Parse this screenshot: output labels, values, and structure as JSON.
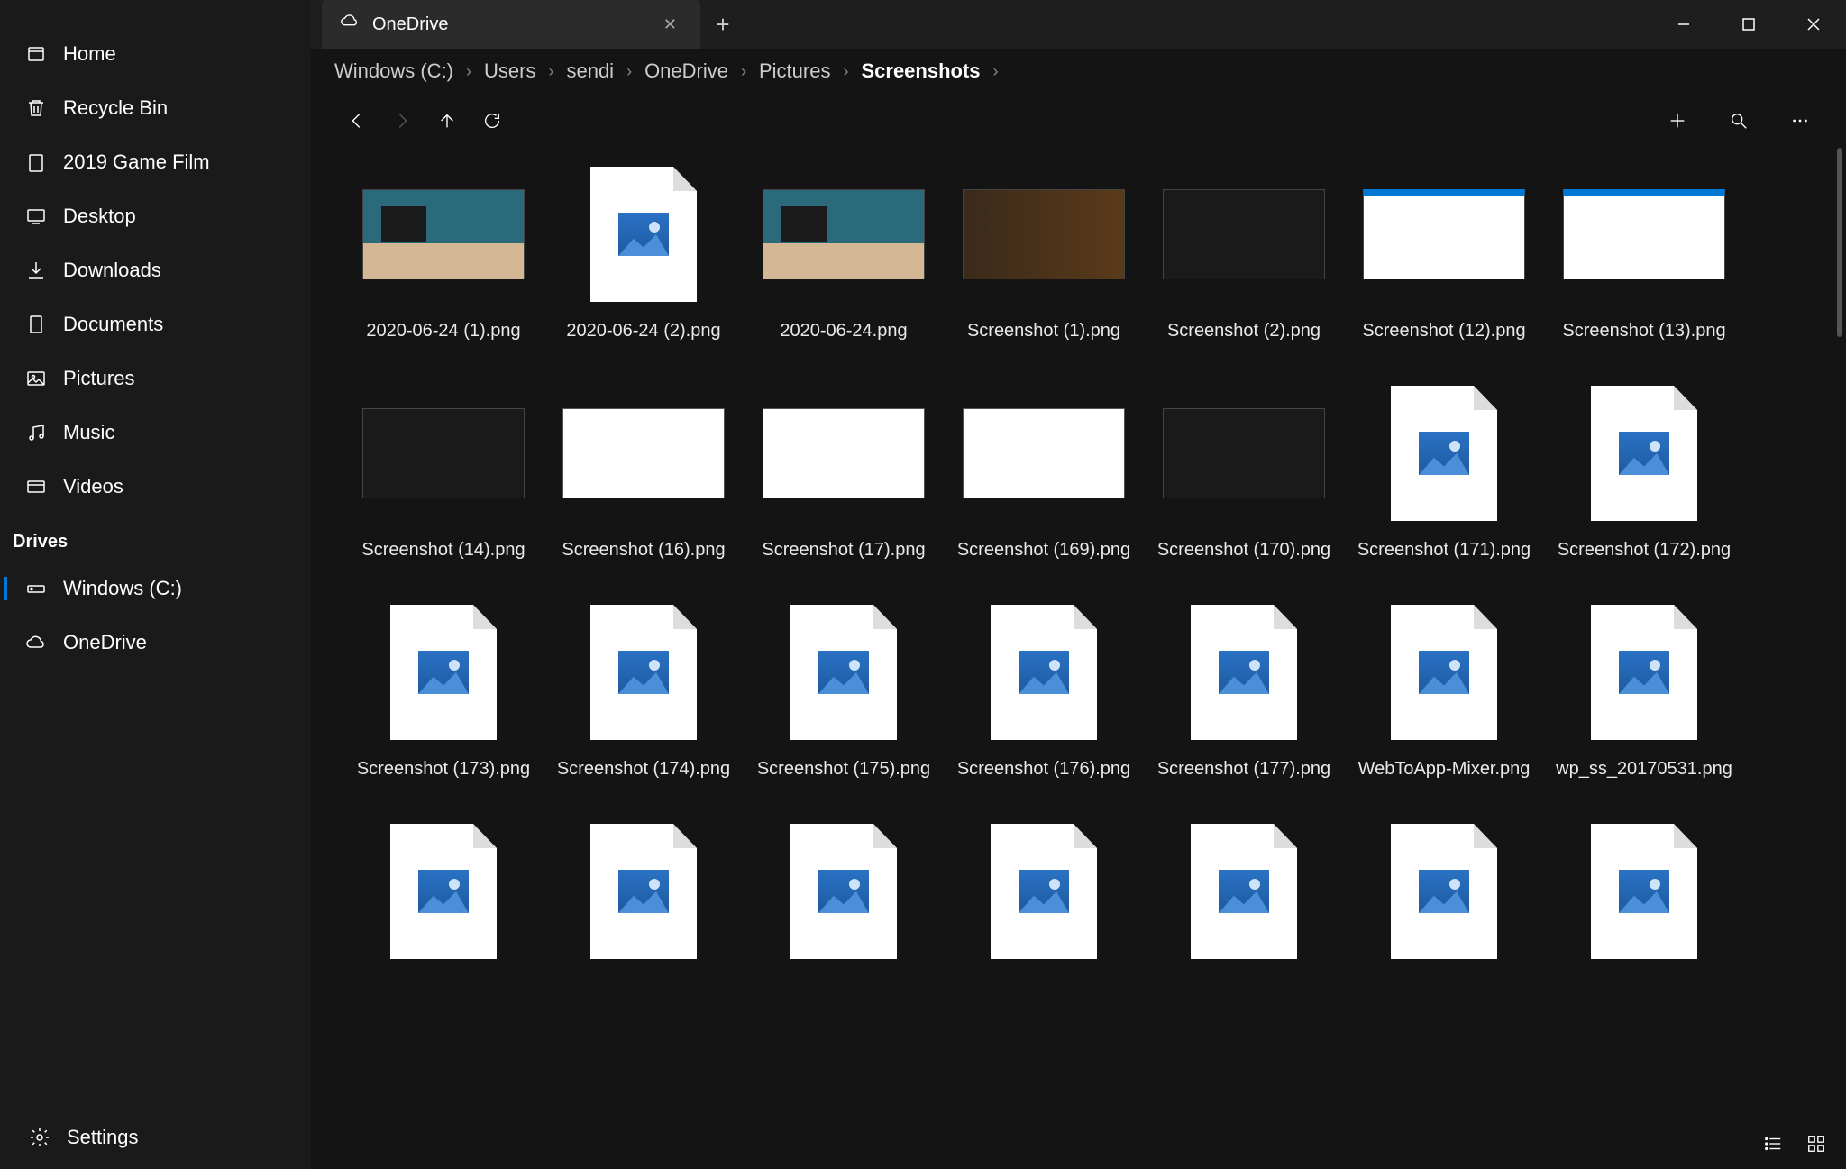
{
  "sidebar": {
    "items": [
      {
        "label": "Home",
        "icon": "home"
      },
      {
        "label": "Recycle Bin",
        "icon": "trash"
      },
      {
        "label": "2019 Game Film",
        "icon": "folder"
      },
      {
        "label": "Desktop",
        "icon": "desktop"
      },
      {
        "label": "Downloads",
        "icon": "download"
      },
      {
        "label": "Documents",
        "icon": "document"
      },
      {
        "label": "Pictures",
        "icon": "picture"
      },
      {
        "label": "Music",
        "icon": "music"
      },
      {
        "label": "Videos",
        "icon": "video"
      }
    ],
    "drives_header": "Drives",
    "drives": [
      {
        "label": "Windows (C:)",
        "icon": "drive",
        "active": true
      },
      {
        "label": "OneDrive",
        "icon": "cloud"
      }
    ],
    "settings_label": "Settings"
  },
  "tab": {
    "label": "OneDrive"
  },
  "breadcrumb": [
    "Windows (C:)",
    "Users",
    "sendi",
    "OneDrive",
    "Pictures",
    "Screenshots"
  ],
  "files": [
    {
      "name": "2020-06-24 (1).png",
      "thumb": "desktop"
    },
    {
      "name": "2020-06-24 (2).png",
      "thumb": "doc"
    },
    {
      "name": "2020-06-24.png",
      "thumb": "desktop"
    },
    {
      "name": "Screenshot (1).png",
      "thumb": "brown"
    },
    {
      "name": "Screenshot (2).png",
      "thumb": "tiles"
    },
    {
      "name": "Screenshot (12).png",
      "thumb": "bluetop"
    },
    {
      "name": "Screenshot (13).png",
      "thumb": "bluetop"
    },
    {
      "name": "Screenshot (14).png",
      "thumb": "dark"
    },
    {
      "name": "Screenshot (16).png",
      "thumb": "white"
    },
    {
      "name": "Screenshot (17).png",
      "thumb": "white"
    },
    {
      "name": "Screenshot (169).png",
      "thumb": "white"
    },
    {
      "name": "Screenshot (170).png",
      "thumb": "dark"
    },
    {
      "name": "Screenshot (171).png",
      "thumb": "doc"
    },
    {
      "name": "Screenshot (172).png",
      "thumb": "doc"
    },
    {
      "name": "Screenshot (173).png",
      "thumb": "doc"
    },
    {
      "name": "Screenshot (174).png",
      "thumb": "doc"
    },
    {
      "name": "Screenshot (175).png",
      "thumb": "doc"
    },
    {
      "name": "Screenshot (176).png",
      "thumb": "doc"
    },
    {
      "name": "Screenshot (177).png",
      "thumb": "doc"
    },
    {
      "name": "WebToApp-Mixer.png",
      "thumb": "doc"
    },
    {
      "name": "wp_ss_20170531.png",
      "thumb": "doc"
    },
    {
      "name": "",
      "thumb": "doc"
    },
    {
      "name": "",
      "thumb": "doc"
    },
    {
      "name": "",
      "thumb": "doc"
    },
    {
      "name": "",
      "thumb": "doc"
    },
    {
      "name": "",
      "thumb": "doc"
    },
    {
      "name": "",
      "thumb": "doc"
    },
    {
      "name": "",
      "thumb": "doc"
    }
  ]
}
